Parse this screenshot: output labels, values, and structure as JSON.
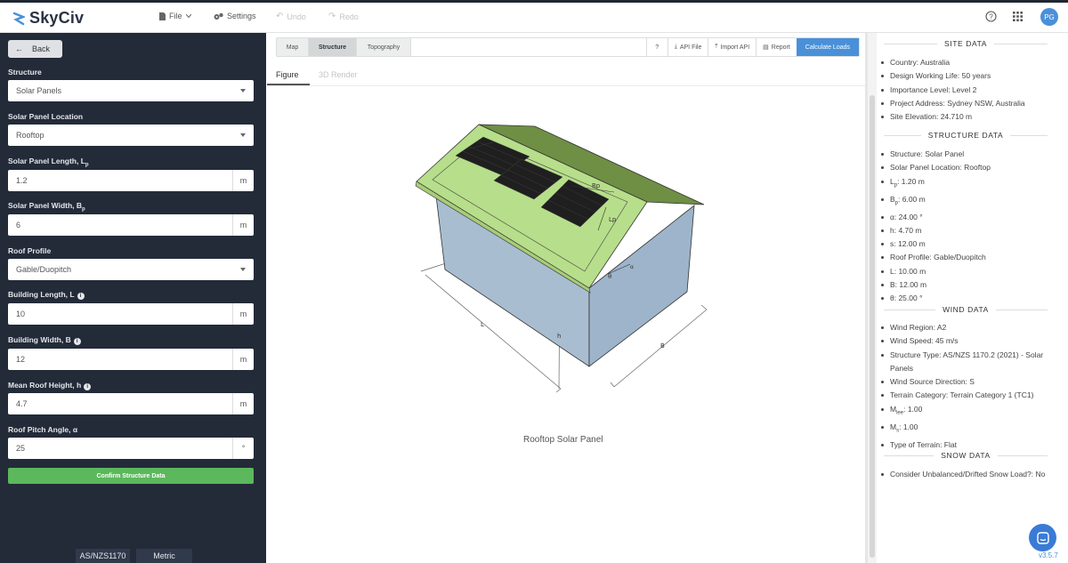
{
  "header": {
    "brand": "SkyCiv",
    "menu": {
      "file": "File",
      "settings": "Settings",
      "undo": "Undo",
      "redo": "Redo"
    },
    "user_initials": "PG"
  },
  "sidebar": {
    "back_label": "Back",
    "fields": {
      "structure": {
        "label": "Structure",
        "value": "Solar Panels"
      },
      "location": {
        "label": "Solar Panel Location",
        "value": "Rooftop"
      },
      "length": {
        "label": "Solar Panel Length, L",
        "sub": "p",
        "value": "1.2",
        "unit": "m"
      },
      "width": {
        "label": "Solar Panel Width, B",
        "sub": "p",
        "value": "6",
        "unit": "m"
      },
      "roof_profile": {
        "label": "Roof Profile",
        "value": "Gable/Duopitch"
      },
      "building_length": {
        "label": "Building Length, L",
        "value": "10",
        "unit": "m"
      },
      "building_width": {
        "label": "Building Width, B",
        "value": "12",
        "unit": "m"
      },
      "roof_height": {
        "label": "Mean Roof Height, h",
        "value": "4.7",
        "unit": "m"
      },
      "pitch_angle": {
        "label": "Roof Pitch Angle, α",
        "value": "25",
        "unit": "°"
      }
    },
    "info_glyph": "i",
    "confirm_label": "Confirm Structure Data",
    "footer": {
      "code": "AS/NZS1170",
      "units": "Metric"
    }
  },
  "toolbar": {
    "tabs": [
      "Map",
      "Structure",
      "Topography"
    ],
    "active_tab": "Structure",
    "help": "?",
    "api_file": "API File",
    "import_api": "Import API",
    "report": "Report",
    "calculate": "Calculate Loads"
  },
  "figure": {
    "tabs": [
      "Figure",
      "3D Render"
    ],
    "active_tab": "Figure",
    "caption": "Rooftop Solar Panel",
    "labels": {
      "bp": "Bp",
      "lp": "Lp",
      "theta": "θ",
      "alpha": "α",
      "L": "L",
      "B": "B",
      "h": "h"
    }
  },
  "right_panel": {
    "site": {
      "title": "SITE DATA",
      "items": [
        "Country: Australia",
        "Design Working Life: 50 years",
        "Importance Level: Level 2",
        "Project Address: Sydney NSW, Australia",
        "Site Elevation: 24.710 m"
      ]
    },
    "structure": {
      "title": "STRUCTURE DATA",
      "items": [
        "Structure: Solar Panel",
        "Solar Panel Location: Rooftop"
      ],
      "lp": {
        "base": "L",
        "sub": "p",
        "rest": ": 1.20 m"
      },
      "bp": {
        "base": "B",
        "sub": "p",
        "rest": ": 6.00 m"
      },
      "items2": [
        "α: 24.00 °",
        "h: 4.70 m",
        "s: 12.00 m",
        "Roof Profile: Gable/Duopitch",
        "L: 10.00 m",
        "B: 12.00 m",
        "θ: 25.00 °"
      ]
    },
    "wind": {
      "title": "WIND DATA",
      "items": [
        "Wind Region: A2",
        "Wind Speed: 45 m/s",
        "Structure Type: AS/NZS 1170.2 (2021) - Solar Panels",
        "Wind Source Direction: S",
        "Terrain Category: Terrain Category 1 (TC1)"
      ],
      "mlee": {
        "base": "M",
        "sub": "lee",
        "rest": ": 1.00"
      },
      "ms": {
        "base": "M",
        "sub": "s",
        "rest": ": 1.00"
      },
      "items2": [
        "Type of Terrain: Flat"
      ]
    },
    "snow": {
      "title": "SNOW DATA",
      "items": [
        "Consider Unbalanced/Drifted Snow Load?: No"
      ]
    },
    "version": "v3.5.7"
  },
  "colors": {
    "accent": "#4a90d9",
    "confirm": "#5cb85c",
    "sidebar": "#232b39",
    "roof": "#b7de8a",
    "wall": "#a6bccf"
  }
}
